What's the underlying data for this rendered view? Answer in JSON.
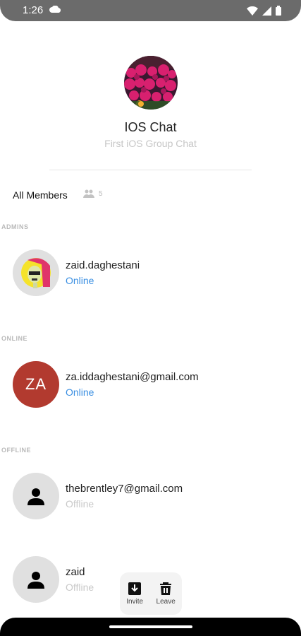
{
  "status_bar": {
    "time": "1:26"
  },
  "group": {
    "title": "IOS Chat",
    "subtitle": "First iOS Group Chat"
  },
  "members_header": {
    "label": "All Members",
    "count": "5"
  },
  "sections": {
    "admins": "ADMINS",
    "online": "ONLINE",
    "offline": "OFFLINE"
  },
  "members": [
    {
      "name": "zaid.daghestani",
      "status": "Online"
    },
    {
      "name": "za.iddaghestani@gmail.com",
      "status": "Online",
      "initials": "ZA"
    },
    {
      "name": "thebrentley7@gmail.com",
      "status": "Offline"
    },
    {
      "name": "zaid",
      "status": "Offline"
    }
  ],
  "actions": {
    "invite": "Invite",
    "leave": "Leave"
  },
  "colors": {
    "online": "#3a8fe2",
    "offline": "#c9c9c9",
    "initials_bg": "#b23a2f"
  },
  "icons": {
    "cloud": "cloud-icon",
    "wifi": "wifi-icon",
    "signal": "signal-icon",
    "battery": "battery-icon",
    "members": "group-icon",
    "person": "person-icon",
    "invite": "invite-icon",
    "leave": "trash-icon"
  }
}
